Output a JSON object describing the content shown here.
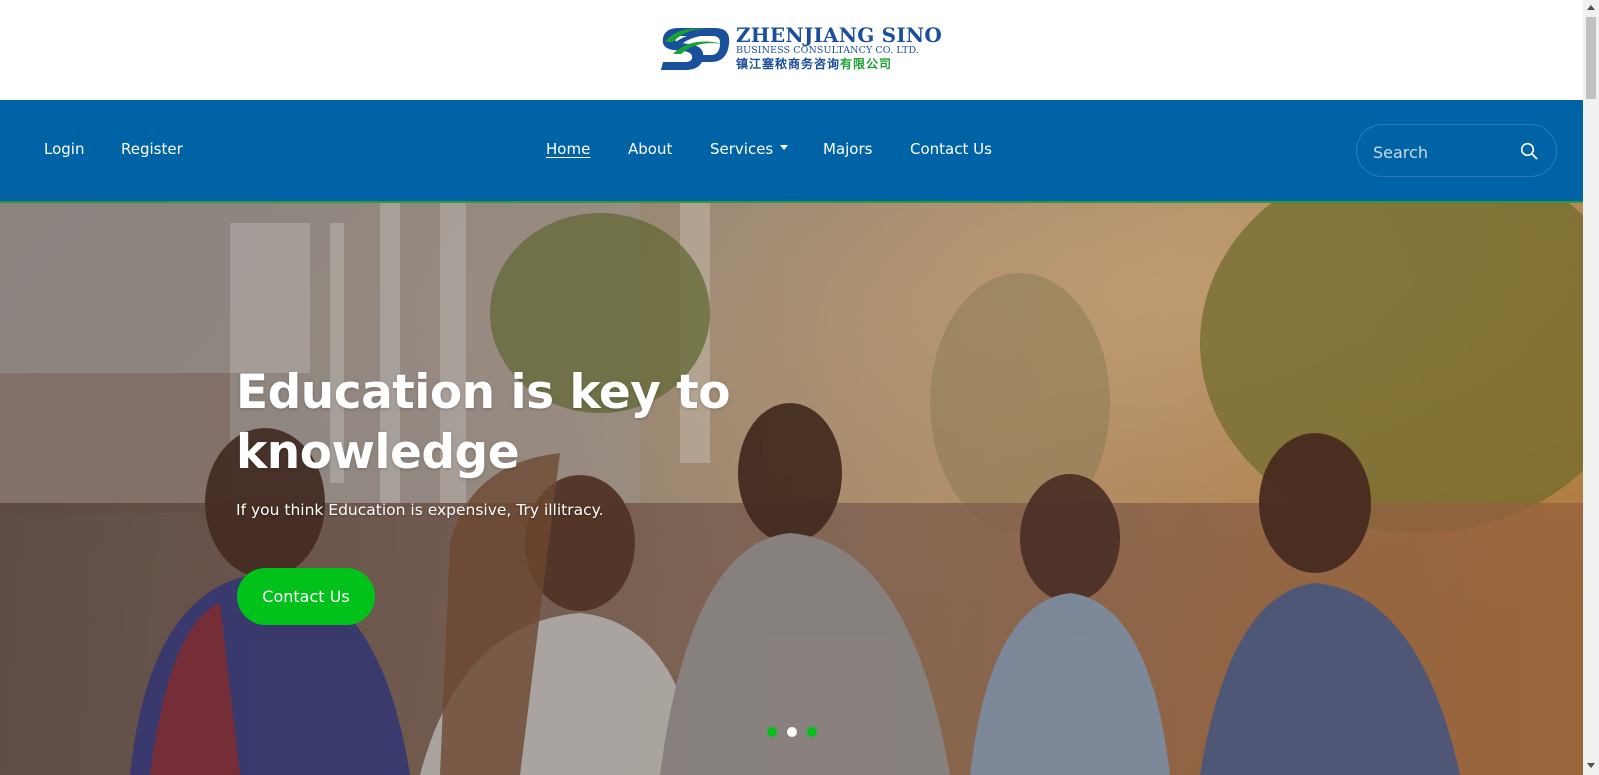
{
  "brand": {
    "name_line1": "ZHENJIANG SINO",
    "name_line2": "BUSINESS CONSULTANCY CO. LTD.",
    "name_cn_blue": "镇江塞秾商务咨询",
    "name_cn_green": "有限公司",
    "colors": {
      "blue": "#1a4f9c",
      "green": "#1aa033"
    }
  },
  "nav": {
    "login": "Login",
    "register": "Register",
    "items": [
      {
        "label": "Home",
        "active": true
      },
      {
        "label": "About"
      },
      {
        "label": "Services",
        "has_dropdown": true
      },
      {
        "label": "Majors"
      },
      {
        "label": "Contact Us"
      }
    ],
    "search_placeholder": "Search",
    "search_icon": "search-icon",
    "background_color": "#0063a5"
  },
  "hero": {
    "title": "Education is key to knowledge",
    "subtitle": "If you think Education is expensive, Try illitracy.",
    "cta_label": "Contact Us",
    "cta_color": "#00c21a",
    "slide_dots": [
      {
        "active": false,
        "color": "#00c21a"
      },
      {
        "active": true,
        "color": "#ffffff"
      },
      {
        "active": false,
        "color": "#00c21a"
      }
    ]
  }
}
